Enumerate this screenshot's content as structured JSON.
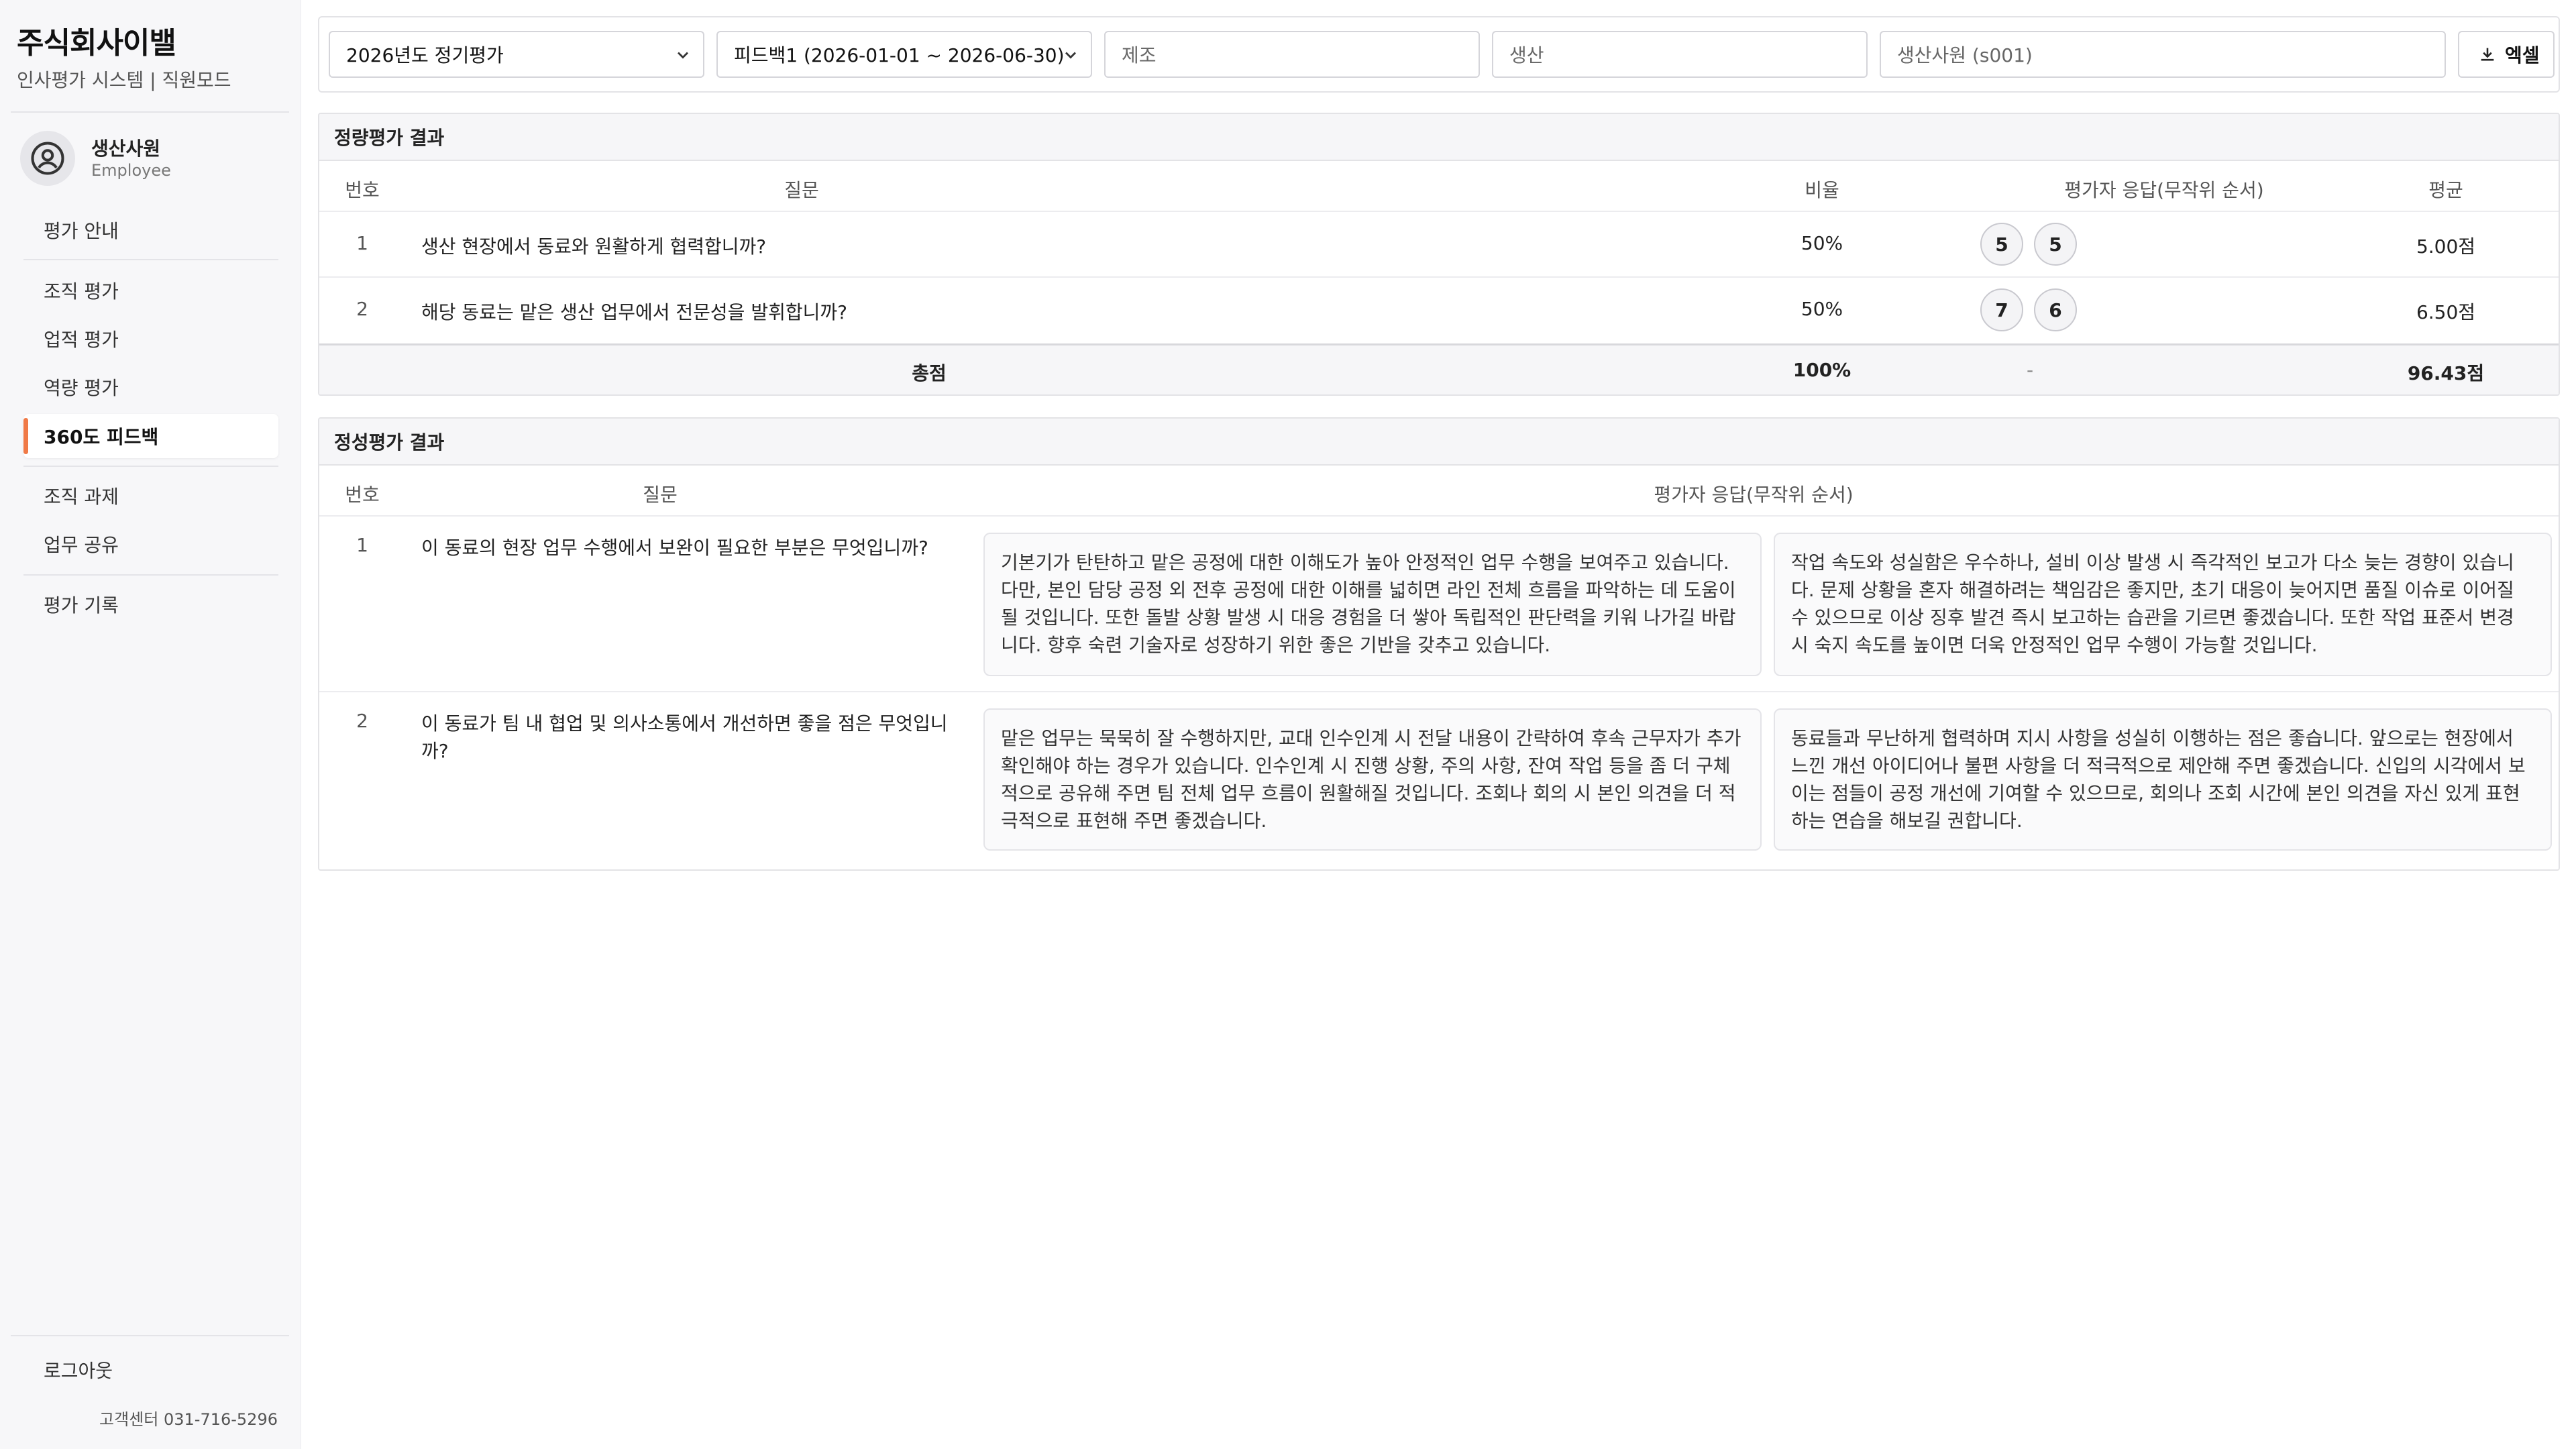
{
  "sidebar": {
    "company": "주식회사이밸",
    "subtitle": "인사평가 시스템 | 직원모드",
    "user": {
      "name": "생산사원",
      "role": "Employee"
    },
    "nav": [
      {
        "label": "평가 안내"
      },
      {
        "label": "조직 평가"
      },
      {
        "label": "업적 평가"
      },
      {
        "label": "역량 평가"
      },
      {
        "label": "360도 피드백"
      },
      {
        "label": "조직 과제"
      },
      {
        "label": "업무 공유"
      },
      {
        "label": "평가 기록"
      }
    ],
    "active_index": 4,
    "logout": "로그아웃",
    "support": "고객센터  031-716-5296",
    "accent": "#f07a47"
  },
  "filters": {
    "period": "2026년도 정기평가",
    "round": "피드백1 (2026-01-01 ~ 2026-06-30)",
    "department": "제조",
    "team": "생산",
    "employee": "생산사원 (s001)",
    "export_label": "엑셀",
    "export_icon": "download-icon"
  },
  "quantitative": {
    "title": "정량평가 결과",
    "headers": {
      "no": "번호",
      "question": "질문",
      "ratio": "비율",
      "responses": "평가자 응답(무작위 순서)",
      "average": "평균"
    },
    "rows": [
      {
        "no": "1",
        "question": "생산 현장에서 동료와 원활하게 협력합니까?",
        "ratio": "50%",
        "scores": [
          "5",
          "5"
        ],
        "average": "5.00점"
      },
      {
        "no": "2",
        "question": "해당 동료는 맡은 생산 업무에서 전문성을 발휘합니까?",
        "ratio": "50%",
        "scores": [
          "7",
          "6"
        ],
        "average": "6.50점"
      }
    ],
    "total": {
      "label": "총점",
      "ratio": "100%",
      "responses": "-",
      "average": "96.43점"
    }
  },
  "qualitative": {
    "title": "정성평가 결과",
    "headers": {
      "no": "번호",
      "question": "질문",
      "responses": "평가자 응답(무작위 순서)"
    },
    "rows": [
      {
        "no": "1",
        "question": "이 동료의 현장 업무 수행에서 보완이 필요한 부분은 무엇입니까?",
        "answers": [
          "기본기가 탄탄하고 맡은 공정에 대한 이해도가 높아 안정적인 업무 수행을 보여주고 있습니다. 다만, 본인 담당 공정 외 전후 공정에 대한 이해를 넓히면 라인 전체 흐름을 파악하는 데 도움이 될 것입니다. 또한 돌발 상황 발생 시 대응 경험을 더 쌓아 독립적인 판단력을 키워 나가길 바랍니다. 향후 숙련 기술자로 성장하기 위한 좋은 기반을 갖추고 있습니다.",
          "작업 속도와 성실함은 우수하나, 설비 이상 발생 시 즉각적인 보고가 다소 늦는 경향이 있습니다. 문제 상황을 혼자 해결하려는 책임감은 좋지만, 초기 대응이 늦어지면 품질 이슈로 이어질 수 있으므로 이상 징후 발견 즉시 보고하는 습관을 기르면 좋겠습니다. 또한 작업 표준서 변경 시 숙지 속도를 높이면 더욱 안정적인 업무 수행이 가능할 것입니다."
        ]
      },
      {
        "no": "2",
        "question": "이 동료가 팀 내 협업 및 의사소통에서 개선하면 좋을 점은 무엇입니까?",
        "answers": [
          "맡은 업무는 묵묵히 잘 수행하지만, 교대 인수인계 시 전달 내용이 간략하여 후속 근무자가 추가 확인해야 하는 경우가 있습니다. 인수인계 시 진행 상황, 주의 사항, 잔여 작업 등을 좀 더 구체적으로 공유해 주면 팀 전체 업무 흐름이 원활해질 것입니다. 조회나 회의 시 본인 의견을 더 적극적으로 표현해 주면 좋겠습니다.",
          "동료들과 무난하게 협력하며 지시 사항을 성실히 이행하는 점은 좋습니다. 앞으로는 현장에서 느낀 개선 아이디어나 불편 사항을 더 적극적으로 제안해 주면 좋겠습니다. 신입의 시각에서 보이는 점들이 공정 개선에 기여할 수 있으므로, 회의나 조회 시간에 본인 의견을 자신 있게 표현하는 연습을 해보길 권합니다."
        ]
      }
    ]
  }
}
